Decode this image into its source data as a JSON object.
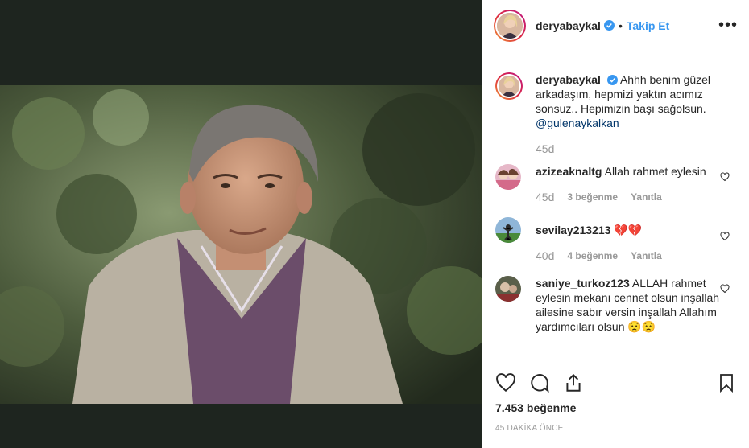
{
  "post": {
    "author": "deryabaykal",
    "follow_label": "Takip Et",
    "dot": "•",
    "more_label": "•••"
  },
  "caption": {
    "username": "deryabaykal",
    "text": "Ahhh benim güzel arkadaşım, hepmizi yaktın acımız sonsuz.. Hepimizin başı sağolsun.",
    "mention": "@gulenaykalkan",
    "time": "45d"
  },
  "comments": [
    {
      "username": "azizeaknaltg",
      "text": "Allah rahmet eylesin",
      "time": "45d",
      "likes": "3 beğenme",
      "reply": "Yanıtla"
    },
    {
      "username": "sevilay213213",
      "text": "💔💔",
      "time": "40d",
      "likes": "4 beğenme",
      "reply": "Yanıtla"
    },
    {
      "username": "saniye_turkoz123",
      "text": "ALLAH rahmet eylesin mekanı cennet olsun inşallah ailesine sabır versin inşallah Allahım yardımcıları olsun 😟😟",
      "time": "",
      "likes": "",
      "reply": ""
    }
  ],
  "footer": {
    "likes": "7.453 beğenme",
    "posted_ago": "45 DAKİKA ÖNCE"
  },
  "colors": {
    "accent": "#3897f0",
    "text": "#262626",
    "muted": "#999999"
  }
}
